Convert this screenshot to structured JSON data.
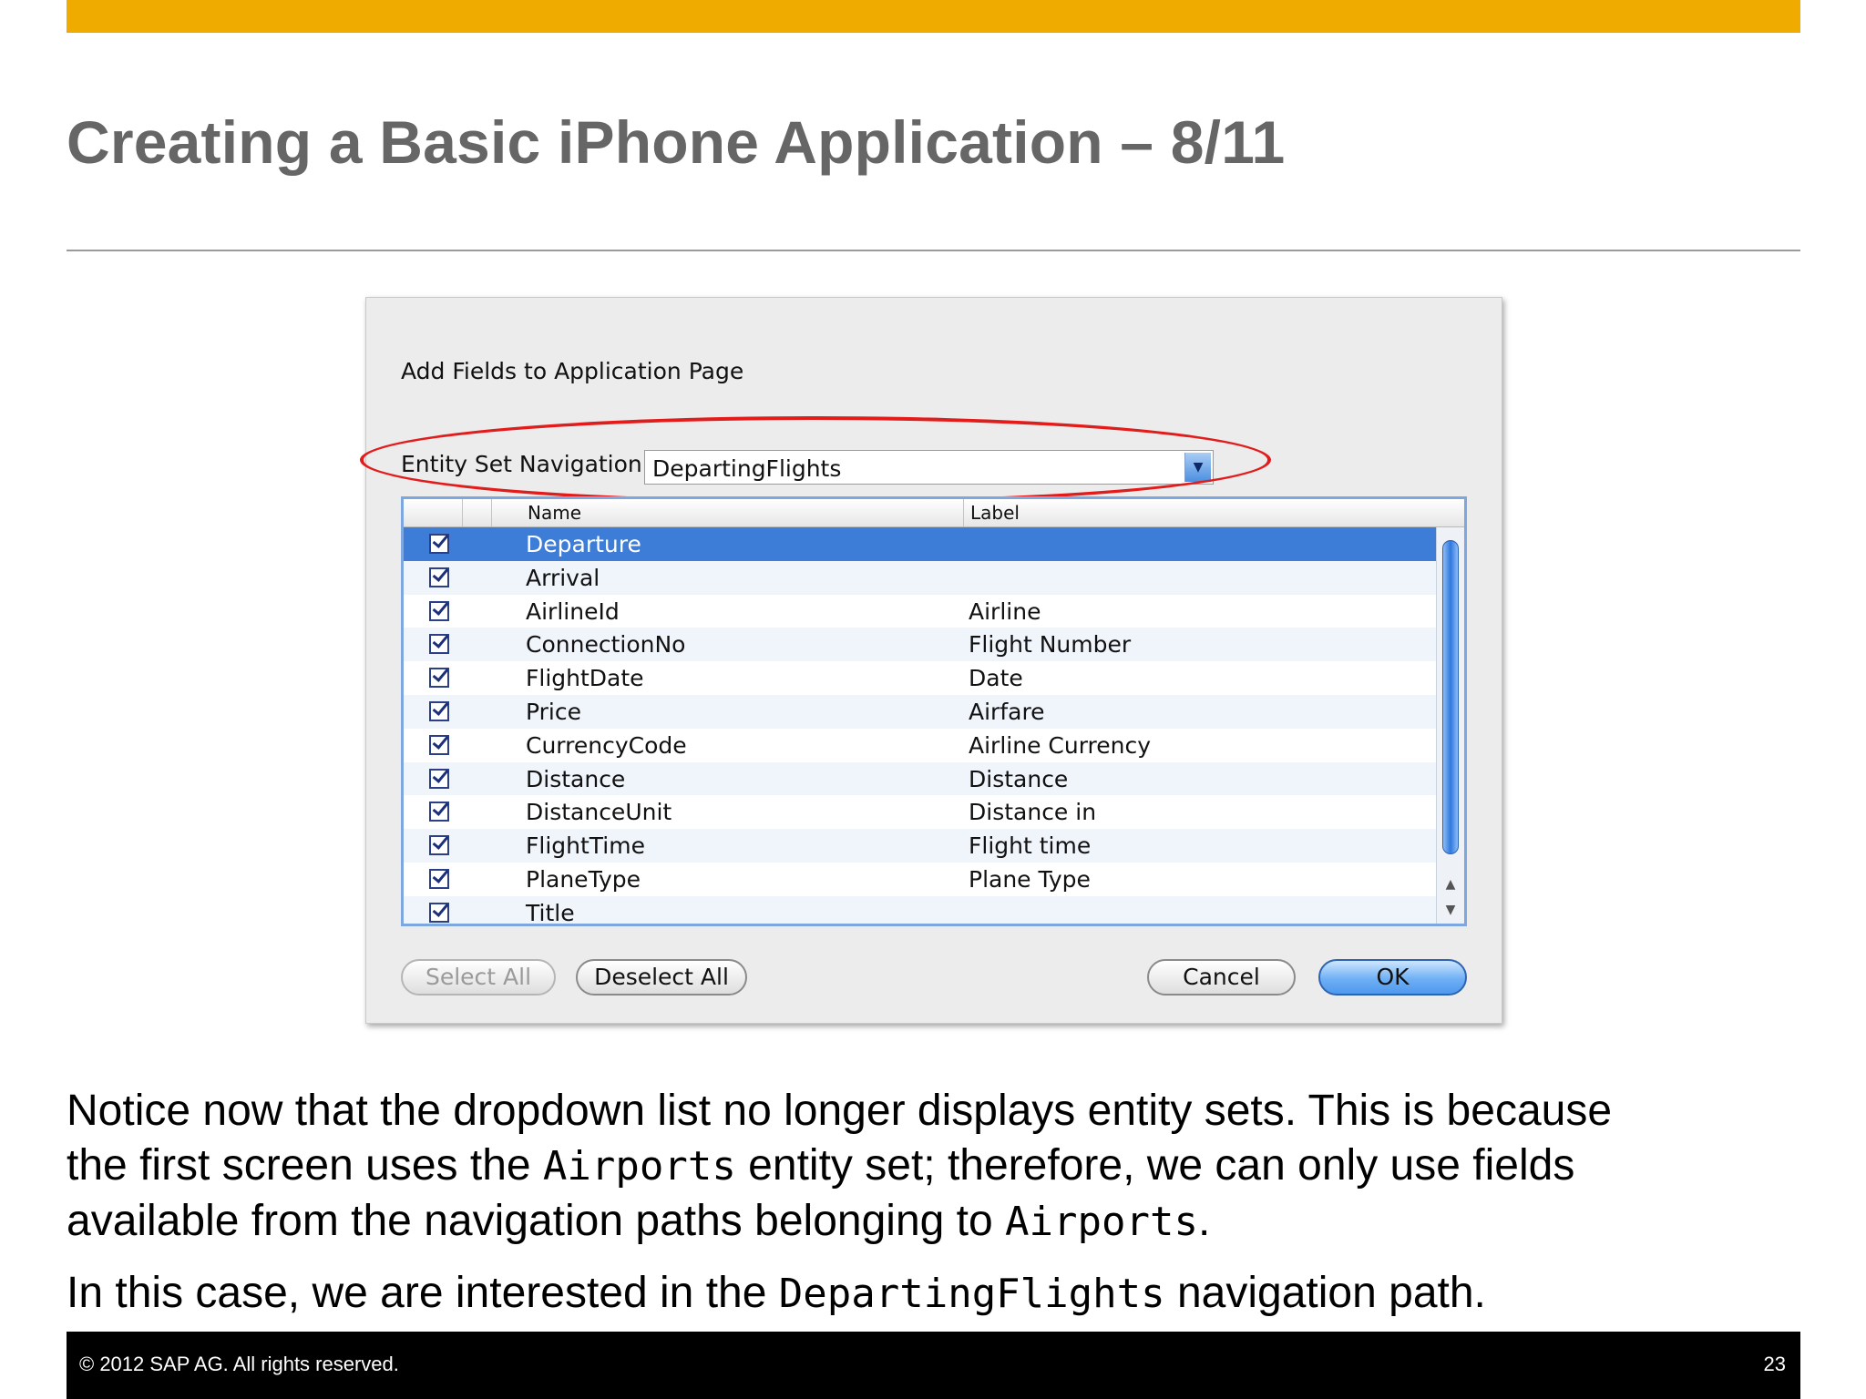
{
  "slide": {
    "title": "Creating a Basic iPhone Application – 8/11"
  },
  "dialog": {
    "title": "Add Fields to Application Page",
    "entity_set_label": "Entity Set Navigation:",
    "entity_set_value": "DepartingFlights",
    "columns": {
      "name": "Name",
      "label": "Label"
    },
    "rows": [
      {
        "name": "Departure",
        "label": "",
        "checked": true,
        "selected": true
      },
      {
        "name": "Arrival",
        "label": "",
        "checked": true,
        "selected": false
      },
      {
        "name": "AirlineId",
        "label": "Airline",
        "checked": true,
        "selected": false
      },
      {
        "name": "ConnectionNo",
        "label": "Flight Number",
        "checked": true,
        "selected": false
      },
      {
        "name": "FlightDate",
        "label": "Date",
        "checked": true,
        "selected": false
      },
      {
        "name": "Price",
        "label": "Airfare",
        "checked": true,
        "selected": false
      },
      {
        "name": "CurrencyCode",
        "label": "Airline Currency",
        "checked": true,
        "selected": false
      },
      {
        "name": "Distance",
        "label": "Distance",
        "checked": true,
        "selected": false
      },
      {
        "name": "DistanceUnit",
        "label": "Distance in",
        "checked": true,
        "selected": false
      },
      {
        "name": "FlightTime",
        "label": "Flight time",
        "checked": true,
        "selected": false
      },
      {
        "name": "PlaneType",
        "label": "Plane Type",
        "checked": true,
        "selected": false
      },
      {
        "name": "Title",
        "label": "",
        "checked": true,
        "selected": false
      }
    ],
    "buttons": {
      "select_all": "Select All",
      "deselect_all": "Deselect All",
      "cancel": "Cancel",
      "ok": "OK"
    }
  },
  "body": {
    "p1_line1": "Notice now that the dropdown list no longer displays entity sets.  This is because",
    "p1_line2_a": "the first screen uses the ",
    "p1_line2_code": "Airports",
    "p1_line2_b": " entity set; therefore, we can only use fields",
    "p1_line3_a": "available from the navigation paths belonging to ",
    "p1_line3_code": "Airports",
    "p1_line3_b": ".",
    "p2_a": "In this case, we are interested in the ",
    "p2_code": "DepartingFlights",
    "p2_b": " navigation path."
  },
  "footer": {
    "copyright": "©  2012 SAP AG. All rights reserved.",
    "page_number": "23"
  },
  "colors": {
    "accent_bar": "#f0ab00",
    "title_text": "#666666",
    "selection": "#3d7dd8",
    "highlight_ring": "#e21b1b"
  }
}
